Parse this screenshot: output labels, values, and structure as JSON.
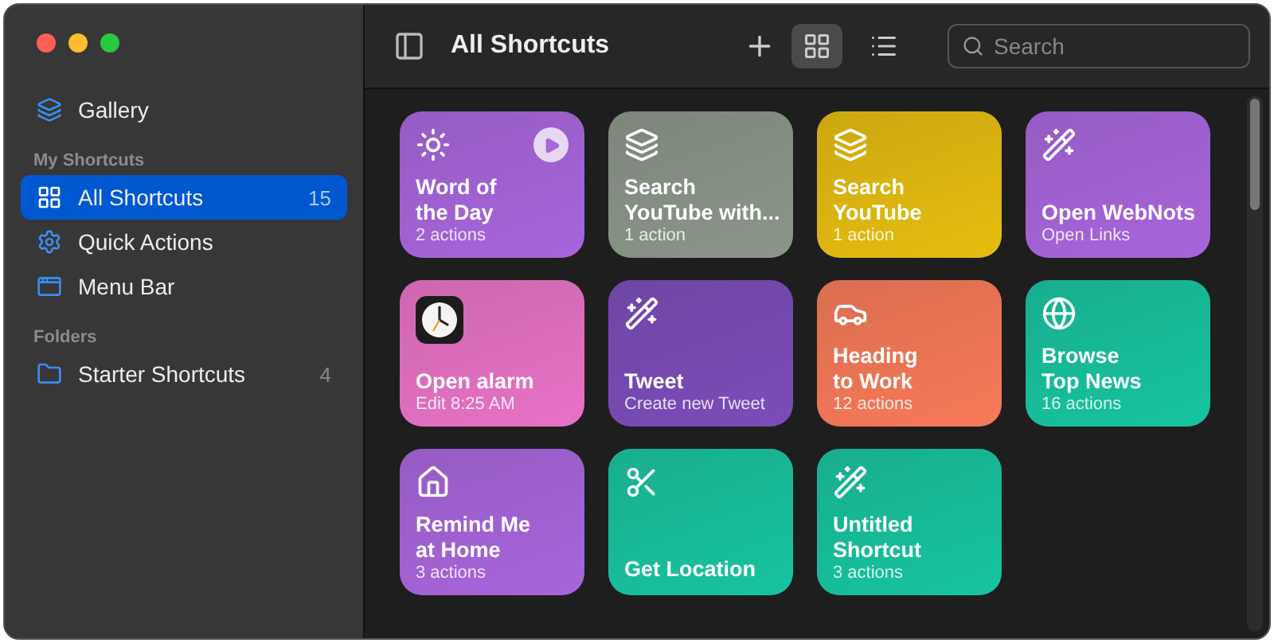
{
  "sidebar": {
    "top_items": [
      {
        "label": "Gallery",
        "kind": "layers",
        "selected": false
      }
    ],
    "sections": [
      {
        "heading": "My Shortcuts",
        "items": [
          {
            "label": "All Shortcuts",
            "kind": "grid",
            "count": "15",
            "selected": true
          },
          {
            "label": "Quick Actions",
            "kind": "gear",
            "selected": false
          },
          {
            "label": "Menu Bar",
            "kind": "window",
            "selected": false
          }
        ]
      },
      {
        "heading": "Folders",
        "items": [
          {
            "label": "Starter Shortcuts",
            "kind": "folder",
            "count": "4",
            "selected": false
          }
        ]
      }
    ]
  },
  "toolbar": {
    "title": "All Shortcuts",
    "view_buttons": [
      {
        "kind": "grid",
        "selected": true
      },
      {
        "kind": "list",
        "selected": false
      }
    ],
    "search": {
      "placeholder": "Search"
    }
  },
  "shortcuts": [
    {
      "title": [
        "Word of",
        "the Day"
      ],
      "subtitle": "2 actions",
      "kind": "sun",
      "color": "#a865dc",
      "hovered": true
    },
    {
      "title": [
        "Search",
        "YouTube with..."
      ],
      "subtitle": "1 action",
      "kind": "layers",
      "color": "#8a9788",
      "hovered": false
    },
    {
      "title": [
        "Search",
        "YouTube"
      ],
      "subtitle": "1 action",
      "kind": "layers",
      "color": "#e6bd0f",
      "hovered": false
    },
    {
      "title": [
        "Open WebNots"
      ],
      "subtitle": "Open Links",
      "kind": "wand",
      "color": "#a865dc",
      "hovered": false
    },
    {
      "title": [
        "Open alarm"
      ],
      "subtitle": "Edit 8:25 AM",
      "kind": "clock",
      "color": "#e872c6",
      "hovered": false
    },
    {
      "title": [
        "Tweet"
      ],
      "subtitle": "Create new Tweet",
      "kind": "wand",
      "color": "#7b4cb8",
      "hovered": false
    },
    {
      "title": [
        "Heading",
        "to Work"
      ],
      "subtitle": "12 actions",
      "kind": "car",
      "color": "#f77a58",
      "hovered": false
    },
    {
      "title": [
        "Browse",
        "Top News"
      ],
      "subtitle": "16 actions",
      "kind": "globe",
      "color": "#17c4a0",
      "hovered": false
    },
    {
      "title": [
        "Remind Me",
        "at Home"
      ],
      "subtitle": "3 actions",
      "kind": "house",
      "color": "#a865dc",
      "hovered": false
    },
    {
      "title": [
        "Get Location"
      ],
      "kind": "scissors",
      "color": "#17c4a0",
      "hovered": false
    },
    {
      "title": [
        "Untitled",
        "Shortcut"
      ],
      "subtitle": "3 actions",
      "kind": "wand",
      "color": "#17c4a0",
      "hovered": false
    }
  ]
}
